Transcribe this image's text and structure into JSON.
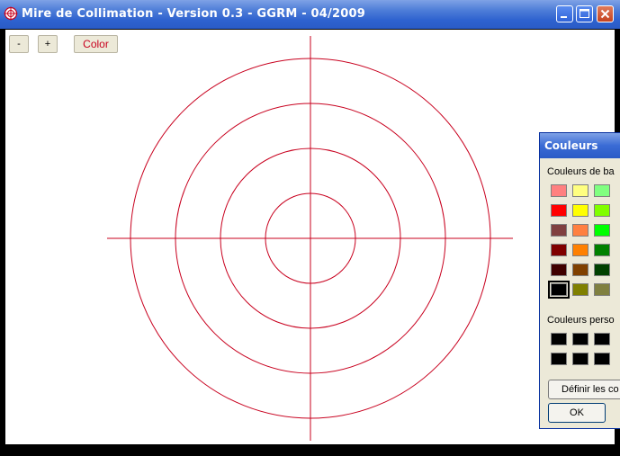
{
  "window": {
    "title": "Mire de Collimation - Version 0.3 - GGRM - 04/2009",
    "controls": [
      "minimize",
      "maximize",
      "close"
    ],
    "icon": "crosshair-icon"
  },
  "toolbar": {
    "minus_label": "-",
    "plus_label": "+",
    "color_label": "Color"
  },
  "target": {
    "line_color": "#c8001e",
    "ring_count": 4,
    "crosshair": true
  },
  "color_dialog": {
    "title": "Couleurs",
    "basic_label": "Couleurs de ba",
    "custom_label": "Couleurs perso",
    "define_label": "Définir les co",
    "ok_label": "OK",
    "basic_colors": [
      [
        "#ff8080",
        "#ffff80",
        "#80ff80"
      ],
      [
        "#ff0000",
        "#ffff00",
        "#80ff00"
      ],
      [
        "#804040",
        "#ff8040",
        "#00ff00"
      ],
      [
        "#800000",
        "#ff8000",
        "#008000"
      ],
      [
        "#400000",
        "#804000",
        "#004000"
      ],
      [
        "#000000",
        "#808000",
        "#808040"
      ]
    ],
    "selected_color": "#000000",
    "custom_colors": [
      [
        "#000000",
        "#000000",
        "#000000"
      ],
      [
        "#000000",
        "#000000",
        "#000000"
      ]
    ]
  }
}
